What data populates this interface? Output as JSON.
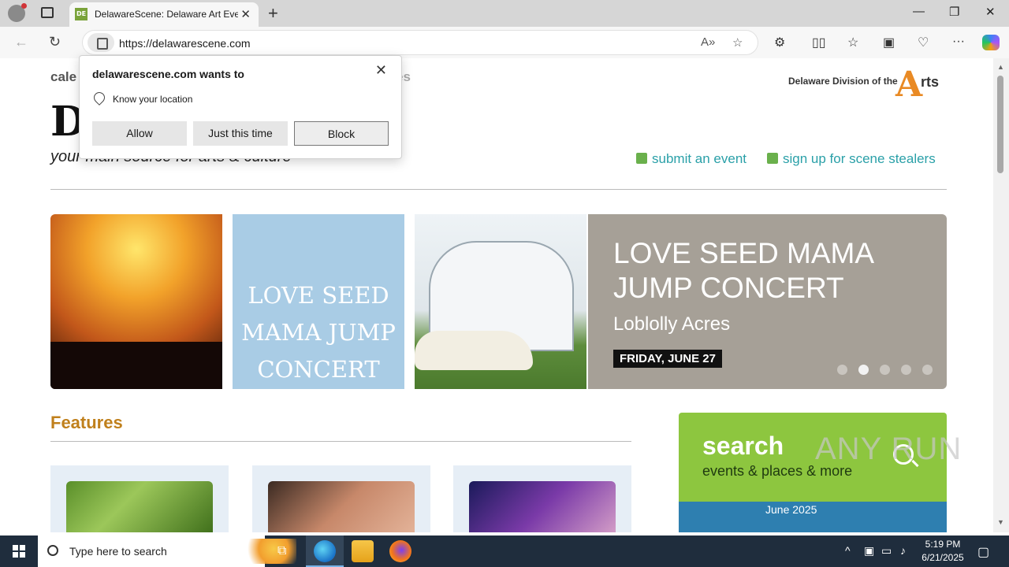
{
  "browser": {
    "tab_title": "DelawareScene: Delaware Art Eve",
    "tab_favicon": "DE",
    "url": "https://delawarescene.com",
    "icons": [
      "profile-icon",
      "tabs-icon",
      "close-icon",
      "new-tab-icon",
      "minimize-icon",
      "restore-icon",
      "window-close-icon",
      "back-icon",
      "refresh-icon",
      "lock-icon",
      "read-aloud-icon",
      "favorite-icon",
      "extensions-icon",
      "split-screen-icon",
      "favorites-icon",
      "collections-icon",
      "browser-essentials-icon",
      "more-icon",
      "copilot-icon"
    ]
  },
  "permission_prompt": {
    "title": "delawarescene.com wants to",
    "permission": "Know your location",
    "allow": "Allow",
    "just_this_time": "Just this time",
    "block": "Block"
  },
  "site": {
    "nav_left": "cale",
    "nav_right": "es",
    "logo_partial": "De",
    "tagline": "your main source for arts & culture",
    "dda_text": "Delaware Division of the",
    "dda_a": "A",
    "dda_rts": "rts",
    "submit_event": "submit an event",
    "sign_up": "sign up for scene stealers",
    "slider": {
      "image_text": "LOVE SEED MAMA JUMP CONCERT",
      "title": "LOVE SEED MAMA JUMP CONCERT",
      "venue": "Loblolly Acres",
      "date": "FRIDAY, JUNE 27",
      "dots": 5,
      "active_dot": 2
    },
    "features_title": "Features",
    "search_title": "search",
    "search_sub": "events & places & more",
    "calendar_partial": "June 2025"
  },
  "taskbar": {
    "search_placeholder": "Type here to search",
    "time": "5:19 PM",
    "date": "6/21/2025",
    "watermark": "ANY RUN"
  }
}
